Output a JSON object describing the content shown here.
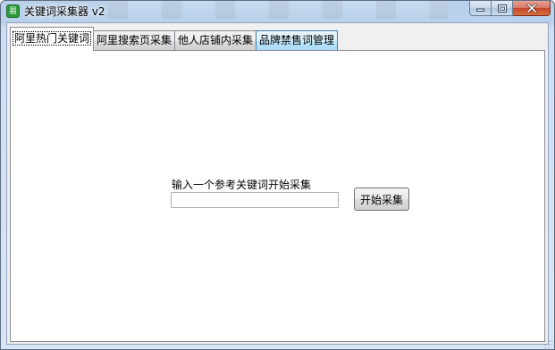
{
  "window": {
    "title": "关键词采集器 v2",
    "app_icon_glyph": "易",
    "app_icon_color": "#2e9b3b",
    "caption_buttons": {
      "minimize_icon": "minimize-icon",
      "maximize_icon": "maximize-icon",
      "close_icon": "close-icon"
    }
  },
  "tabs": [
    {
      "label": "阿里热门关键词",
      "active": true
    },
    {
      "label": "阿里搜索页采集",
      "active": false
    },
    {
      "label": "他人店铺内采集",
      "active": false
    },
    {
      "label": "品牌禁售词管理",
      "active": false,
      "hover": true
    }
  ],
  "main": {
    "prompt_label": "输入一个参考关键词开始采集",
    "keyword_input": {
      "value": "",
      "placeholder": ""
    },
    "start_button_label": "开始采集"
  }
}
